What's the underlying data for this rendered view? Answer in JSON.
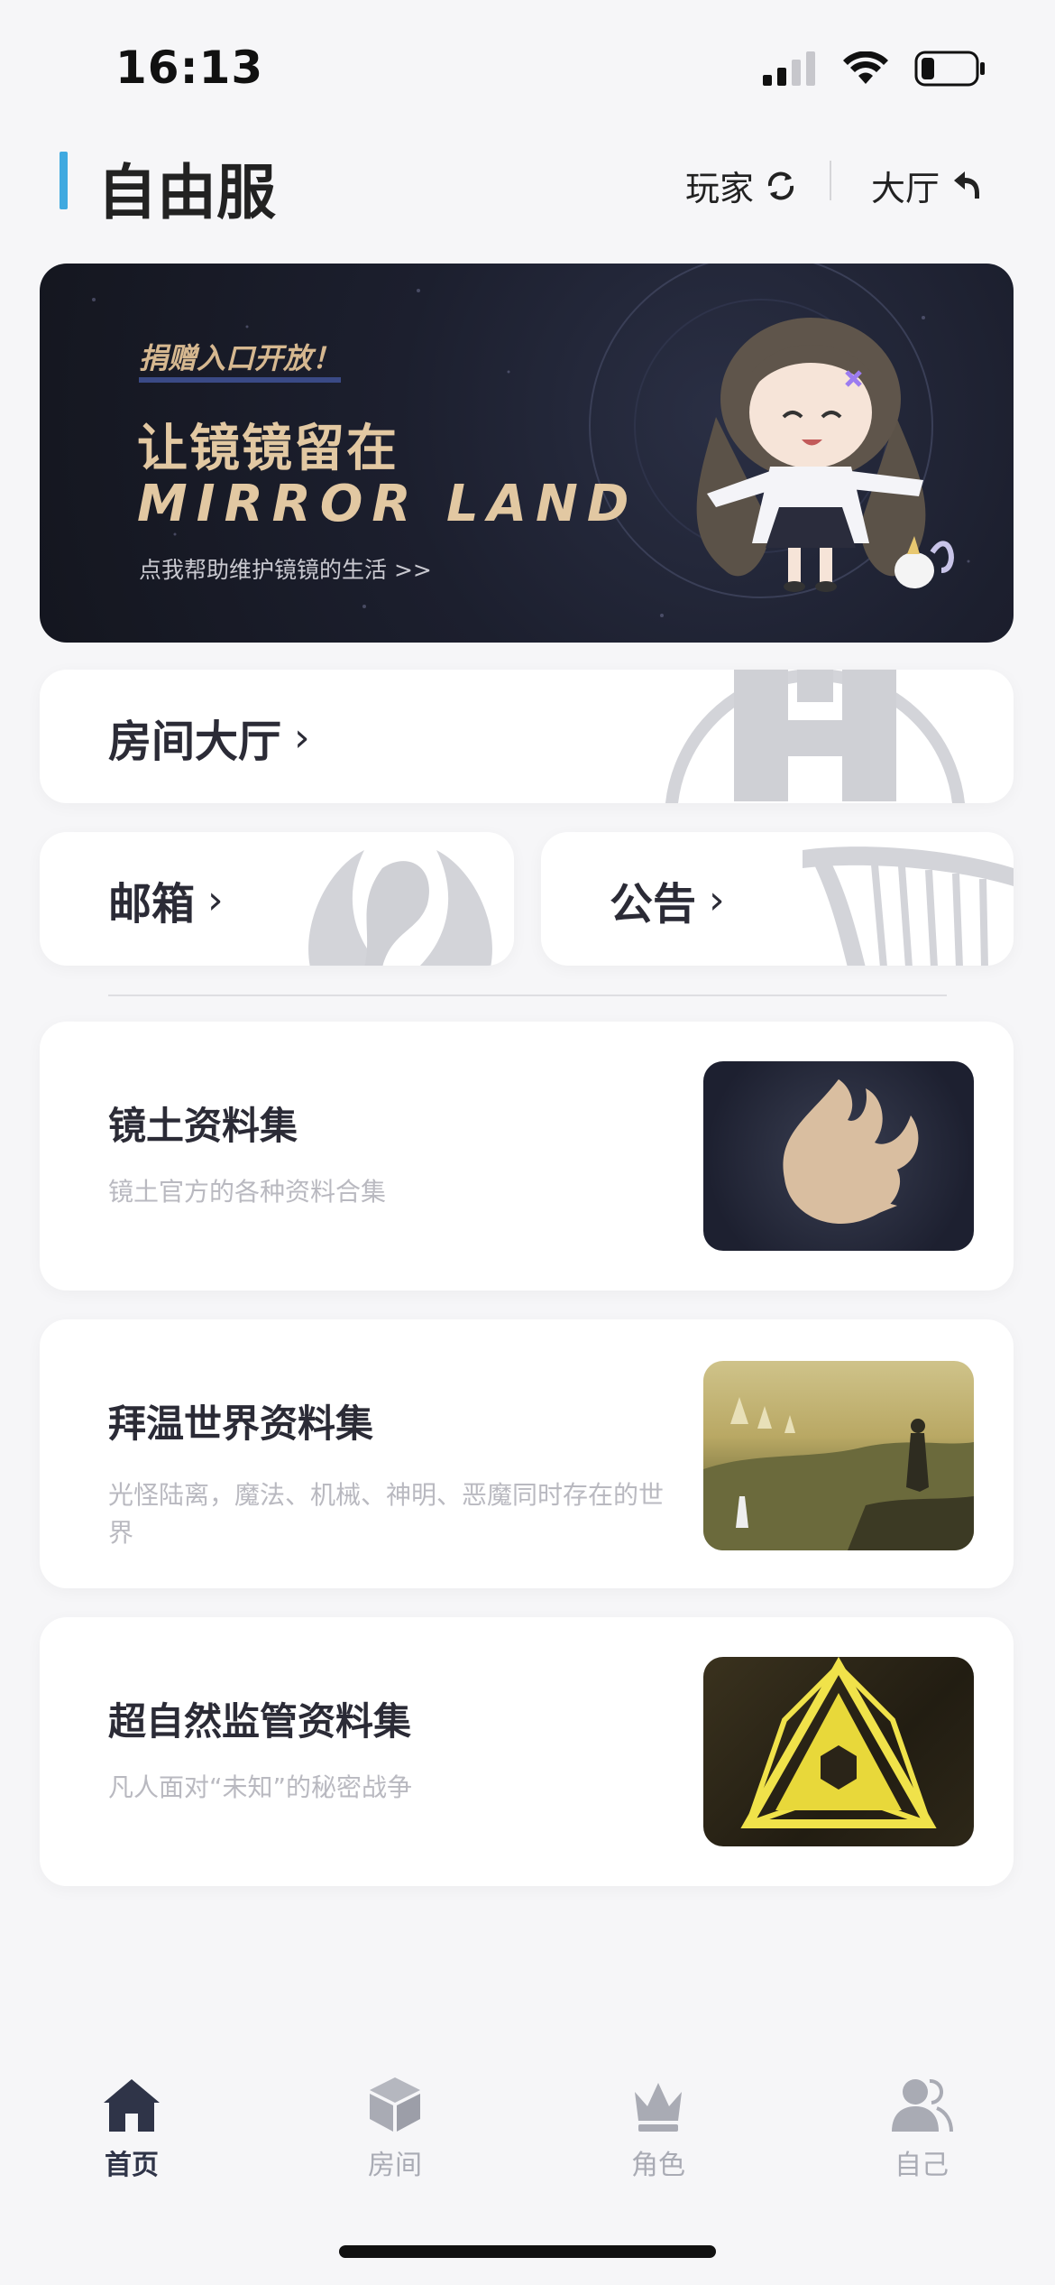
{
  "status": {
    "time": "16:13"
  },
  "header": {
    "title": "自由服",
    "player_label": "玩家",
    "lobby_label": "大厅"
  },
  "banner": {
    "kicker": "捐赠入口开放！",
    "title_line1": "让镜镜留在",
    "title_line2": "MIRROR LAND",
    "subtitle": "点我帮助维护镜镜的生活 >>"
  },
  "cards": {
    "room_lobby": "房间大厅",
    "mailbox": "邮箱",
    "notice": "公告"
  },
  "info_cards": [
    {
      "title": "镜土资料集",
      "desc": "镜土官方的各种资料合集"
    },
    {
      "title": "拜温世界资料集",
      "desc": "光怪陆离，魔法、机械、神明、恶魔同时存在的世界"
    },
    {
      "title": "超自然监管资料集",
      "desc": "凡人面对“未知”的秘密战争"
    }
  ],
  "tabbar": [
    {
      "label": "首页",
      "icon": "home-icon",
      "active": true
    },
    {
      "label": "房间",
      "icon": "cube-icon",
      "active": false
    },
    {
      "label": "角色",
      "icon": "crown-icon",
      "active": false
    },
    {
      "label": "自己",
      "icon": "users-icon",
      "active": false
    }
  ],
  "colors": {
    "accent": "#3fa9e0",
    "tab_active": "#2f3448",
    "tab_inactive": "#a9abb4",
    "banner_text": "#e2c8a2"
  }
}
